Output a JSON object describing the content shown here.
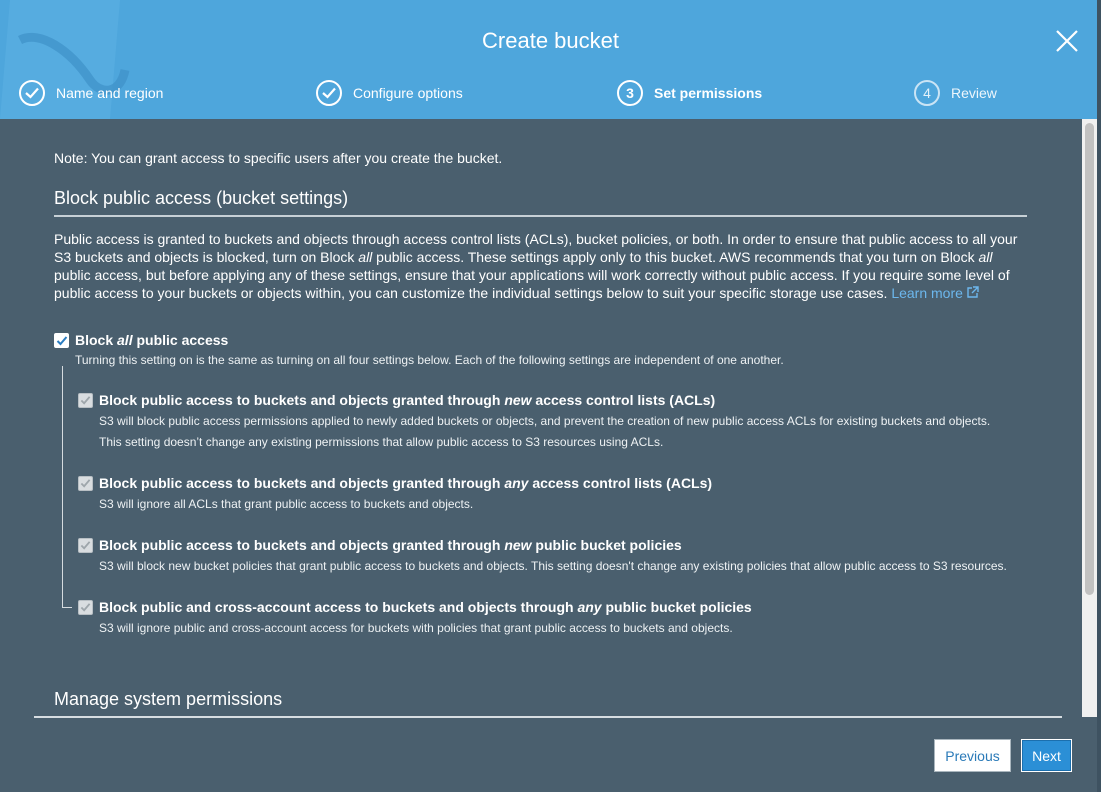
{
  "dialog": {
    "title": "Create bucket",
    "close_icon": "close-icon"
  },
  "steps": [
    {
      "label": "Name and region",
      "status": "complete",
      "marker": "check"
    },
    {
      "label": "Configure options",
      "status": "complete",
      "marker": "check"
    },
    {
      "label": "Set permissions",
      "status": "active",
      "marker": "3"
    },
    {
      "label": "Review",
      "status": "upcoming",
      "marker": "4"
    }
  ],
  "content": {
    "note": "Note: You can grant access to specific users after you create the bucket.",
    "section1_title": "Block public access (bucket settings)",
    "para_part1": "Public access is granted to buckets and objects through access control lists (ACLs), bucket policies, or both. In order to ensure that public access to all your S3 buckets and objects is blocked, turn on Block ",
    "para_em1": "all",
    "para_part2": " public access. These settings apply only to this bucket. AWS recommends that you turn on Block ",
    "para_em2": "all",
    "para_part3": " public access, but before applying any of these settings, ensure that your applications will work correctly without public access. If you require some level of public access to your buckets or objects within, you can customize the individual settings below to suit your specific storage use cases. ",
    "learn_more": "Learn more",
    "block_all": {
      "label_pre": "Block ",
      "label_em": "all",
      "label_post": " public access",
      "checked": true,
      "description": "Turning this setting on is the same as turning on all four settings below. Each of the following settings are independent of one another."
    },
    "settings": [
      {
        "label_pre": "Block public access to buckets and objects granted through ",
        "label_em": "new",
        "label_post": " access control lists (ACLs)",
        "checked": true,
        "disabled": true,
        "desc_lines": [
          "S3 will block public access permissions applied to newly added buckets or objects, and prevent the creation of new public access ACLs for existing buckets and objects.",
          "This setting doesn’t change any existing permissions that allow public access to S3 resources using ACLs."
        ]
      },
      {
        "label_pre": "Block public access to buckets and objects granted through ",
        "label_em": "any",
        "label_post": " access control lists (ACLs)",
        "checked": true,
        "disabled": true,
        "desc_lines": [
          "S3 will ignore all ACLs that grant public access to buckets and objects."
        ]
      },
      {
        "label_pre": "Block public access to buckets and objects granted through ",
        "label_em": "new",
        "label_post": " public bucket policies",
        "checked": true,
        "disabled": true,
        "desc_lines": [
          "S3 will block new bucket policies that grant public access to buckets and objects. This setting doesn't change any existing policies that allow public access to S3 resources."
        ]
      },
      {
        "label_pre": "Block public and cross-account access to buckets and objects through ",
        "label_em": "any",
        "label_post": " public bucket policies",
        "checked": true,
        "disabled": true,
        "desc_lines": [
          "S3 will ignore public and cross-account access for buckets with policies that grant public access to buckets and objects."
        ]
      }
    ],
    "section2_title": "Manage system permissions"
  },
  "footer": {
    "previous_label": "Previous",
    "next_label": "Next"
  },
  "colors": {
    "header_bg": "#4ea6dc",
    "body_bg": "#4a5f6e",
    "link": "#6cb7ed",
    "primary_button": "#2b8fd6"
  }
}
